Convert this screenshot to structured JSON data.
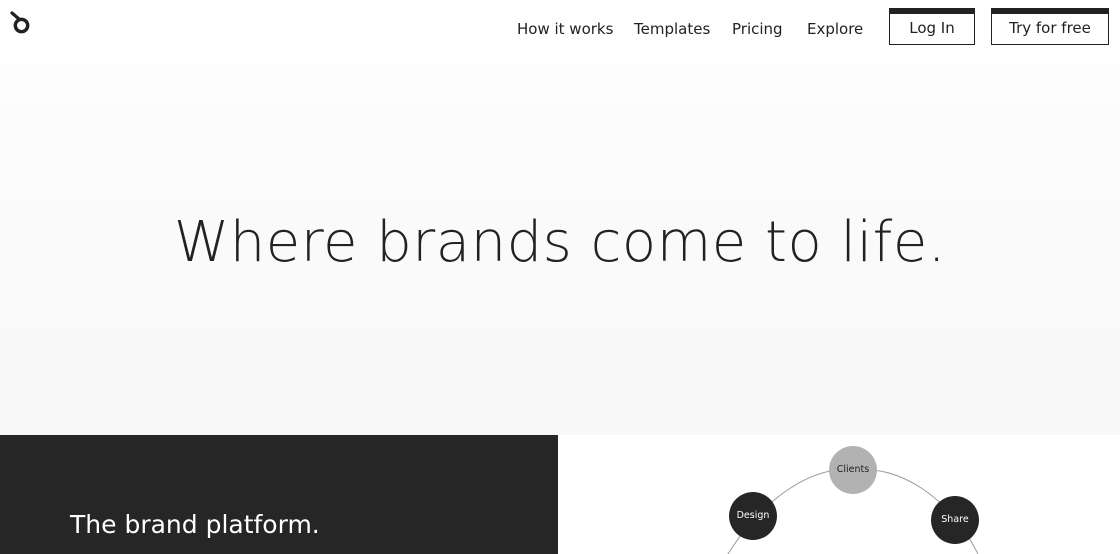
{
  "header": {
    "logo_icon": "brand-b-logo-icon",
    "nav_links": [
      "How it works",
      "Templates",
      "Pricing",
      "Explore"
    ],
    "login_label": "Log In",
    "trial_label": "Try for free"
  },
  "hero": {
    "headline": "Where brands come to life."
  },
  "platform": {
    "title": "The brand platform.",
    "diagram_nodes": {
      "clients": "Clients",
      "design": "Design",
      "share": "Share"
    }
  },
  "colors": {
    "text": "#222222",
    "dark_panel": "#262626",
    "node_dark": "#262626",
    "node_light": "#b2b2b2",
    "background": "#ffffff"
  }
}
